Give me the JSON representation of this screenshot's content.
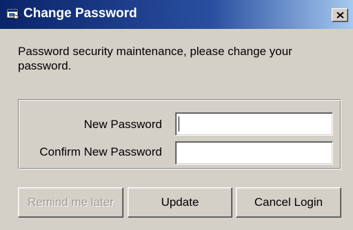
{
  "window": {
    "title": "Change Password"
  },
  "message": "Password security maintenance, please change your password.",
  "form": {
    "new_password_label": "New Password",
    "new_password_value": "",
    "confirm_password_label": "Confirm New Password",
    "confirm_password_value": ""
  },
  "buttons": {
    "remind_label": "Remind me later",
    "update_label": "Update",
    "cancel_label": "Cancel Login"
  },
  "icons": {
    "app": "application-icon",
    "close": "close-icon"
  },
  "colors": {
    "titlebar_start": "#0a246a",
    "titlebar_end": "#a6caf0",
    "face": "#d4d0c8",
    "disabled_text": "#a09d96"
  }
}
